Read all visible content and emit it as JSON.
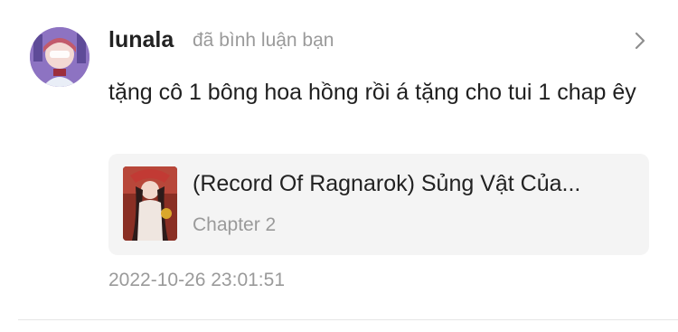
{
  "notification": {
    "avatar_icon": "user-avatar",
    "username": "lunala",
    "action": "đã bình luận bạn",
    "chevron_icon": "chevron-right-icon",
    "comment": "tặng cô 1 bông hoa hồng rồi á tặng cho tui 1 chap êy",
    "card": {
      "cover_icon": "manga-cover-thumbnail",
      "title": "(Record Of Ragnarok) Sủng Vật Của...",
      "subtitle": "Chapter 2"
    },
    "timestamp": "2022-10-26 23:01:51"
  },
  "colors": {
    "primary_text": "#222222",
    "secondary_text": "#9a9a9a",
    "card_background": "#f4f4f4",
    "divider": "#e6e6e6"
  }
}
